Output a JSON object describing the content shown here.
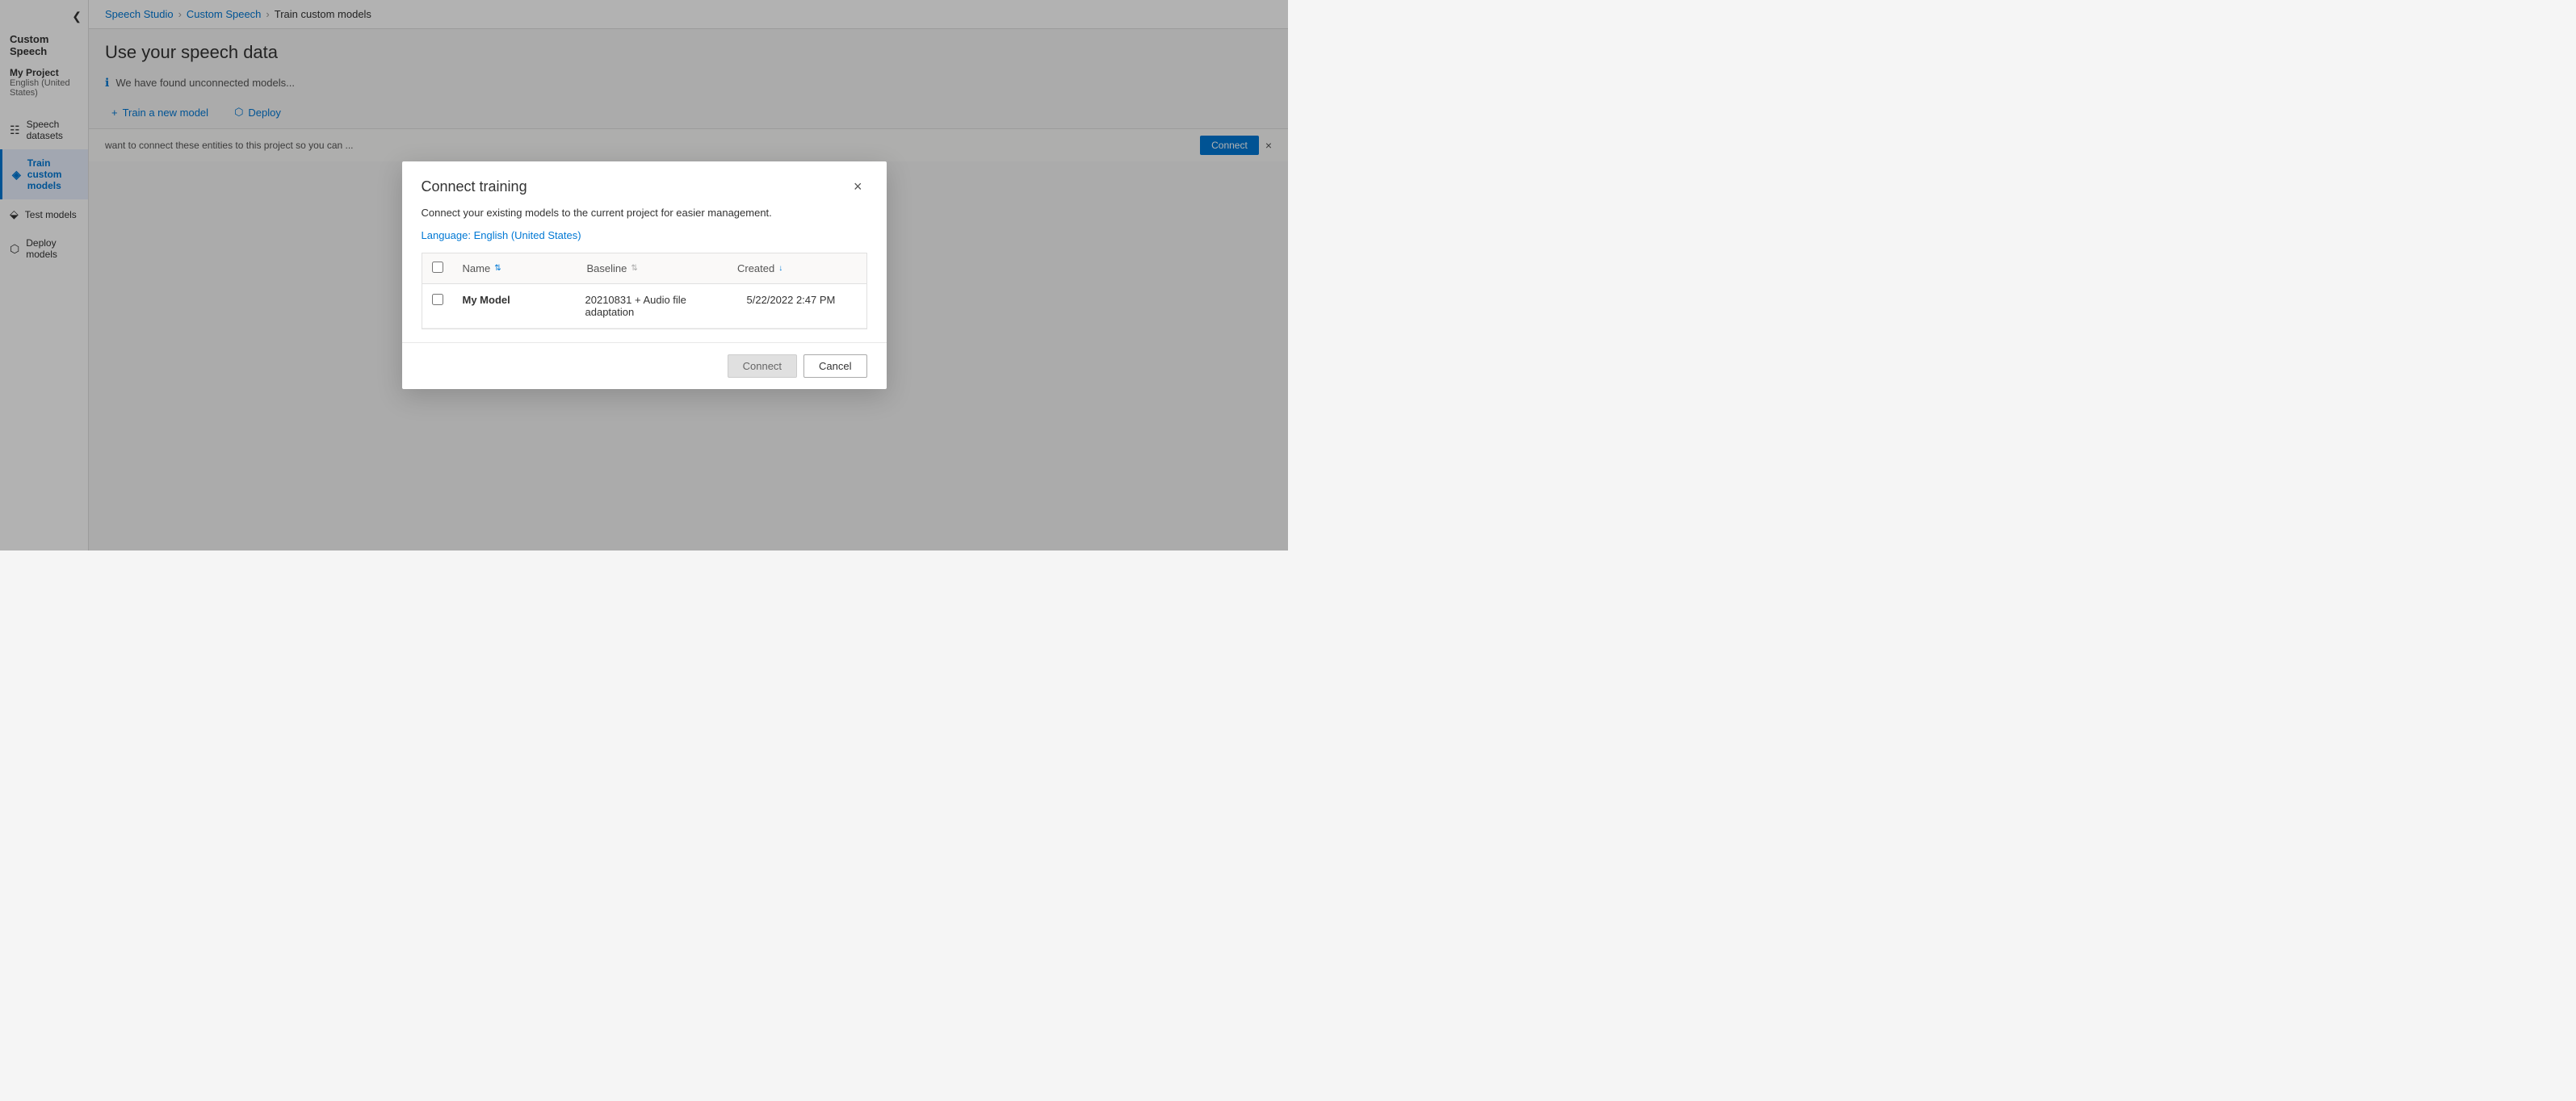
{
  "breadcrumb": {
    "studio": "Speech Studio",
    "custom_speech": "Custom Speech",
    "page": "Train custom models"
  },
  "page": {
    "title": "Use your speech data",
    "info_text": "We have found unconnected models...",
    "connect_banner_text": "want to connect these entities to this project so you can ...",
    "connect_btn": "Connect",
    "close_label": "×"
  },
  "sidebar": {
    "title": "Custom Speech",
    "collapse_icon": "❮",
    "project": {
      "name": "My Project",
      "language": "English (United States)"
    },
    "items": [
      {
        "label": "Speech datasets",
        "icon": "☰"
      },
      {
        "label": "Train custom models",
        "icon": "⬡"
      },
      {
        "label": "Test models",
        "icon": "⬙"
      },
      {
        "label": "Deploy models",
        "icon": "⬡"
      }
    ]
  },
  "toolbar": {
    "train_btn": "Train a new model",
    "deploy_btn": "Deploy"
  },
  "modal": {
    "title": "Connect training",
    "close_icon": "×",
    "description": "Connect your existing models to the current project for easier management.",
    "description_link_text": "",
    "language_label": "Language:",
    "language_value": "English (United States)",
    "table": {
      "columns": [
        {
          "label": "Name",
          "sortable": true,
          "sort_active": true
        },
        {
          "label": "Baseline",
          "sortable": true,
          "sort_active": false
        },
        {
          "label": "Created",
          "sortable": true,
          "sort_active": true,
          "sort_dir": "desc"
        }
      ],
      "rows": [
        {
          "name": "My Model",
          "baseline": "20210831 + Audio file adaptation",
          "created": "5/22/2022 2:47 PM"
        }
      ]
    },
    "footer": {
      "connect_btn": "Connect",
      "cancel_btn": "Cancel"
    }
  }
}
